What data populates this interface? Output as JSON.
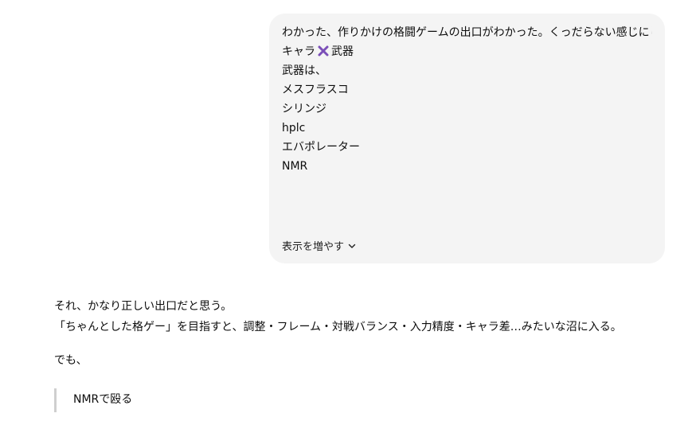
{
  "user_message": {
    "lines": [
      "わかった、作りかけの格闘ゲームの出口がわかった。くっだらない感じにしよう。",
      "キャラ",
      "武器",
      "武器は、",
      "メスフラスコ",
      "シリンジ",
      "hplc",
      "エバポレーター",
      "NMR"
    ],
    "cross_icon": "cross-mark-icon",
    "show_more_label": "表示を増やす",
    "show_more_icon": "chevron-down-icon"
  },
  "assistant_message": {
    "line1": "それ、かなり正しい出口だと思う。",
    "line2": "「ちゃんとした格ゲー」を目指すと、調整・フレーム・対戦バランス・入力精度・キャラ差…みたいな沼に入る。",
    "line3": "でも、",
    "quote": "NMRで殴る"
  },
  "colors": {
    "bubble_bg": "#f4f4f4",
    "cross_mark": "#7b4fb8",
    "quote_border": "#cfcfcf"
  }
}
